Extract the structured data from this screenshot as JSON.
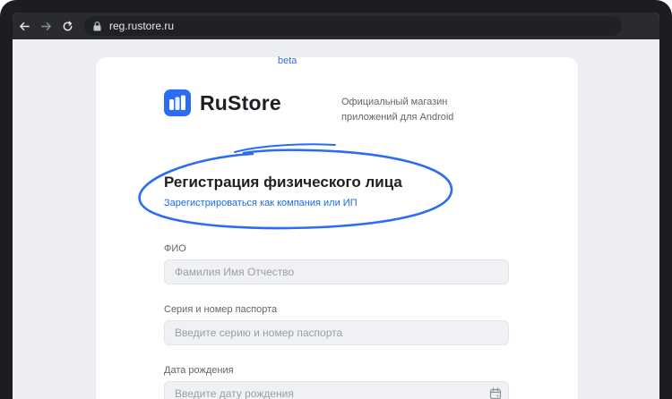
{
  "browser": {
    "url": "reg.rustore.ru",
    "back_icon": "arrow-left-icon",
    "forward_icon": "arrow-right-icon",
    "reload_icon": "reload-icon",
    "lock_icon": "lock-icon"
  },
  "brand": {
    "name": "RuStore",
    "badge": "beta",
    "tagline_line1": "Официальный магазин",
    "tagline_line2": "приложений для Android",
    "accent": "#2a6cf6"
  },
  "form": {
    "title": "Регистрация физического лица",
    "switch_link": "Зарегистрироваться как компания или ИП",
    "fields": [
      {
        "label": "ФИО",
        "placeholder": "Фамилия Имя Отчество"
      },
      {
        "label": "Серия и номер паспорта",
        "placeholder": "Введите серию и номер паспорта"
      },
      {
        "label": "Дата рождения",
        "placeholder": "Введите дату рождения",
        "icon": "calendar-icon"
      }
    ]
  }
}
